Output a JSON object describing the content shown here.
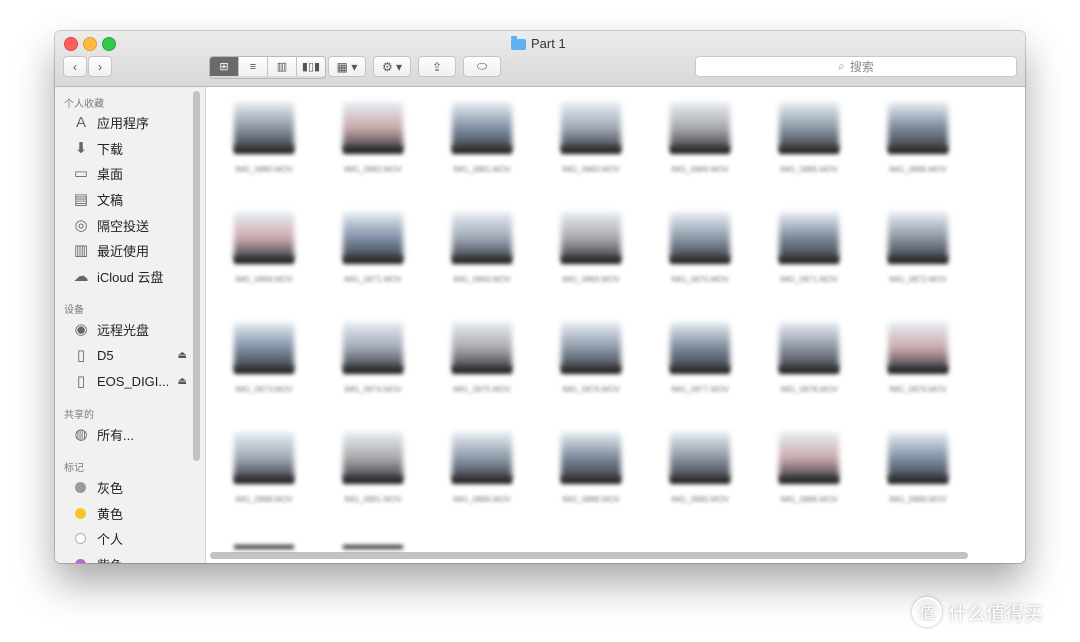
{
  "window": {
    "title": "Part 1"
  },
  "toolbar": {
    "back_icon": "chevron-left",
    "forward_icon": "chevron-right",
    "view_modes": [
      "icon-view",
      "list-view",
      "column-view",
      "cover-flow-view"
    ],
    "view_glyphs": [
      "⊞",
      "≡",
      "▥",
      "▮▯▮"
    ],
    "arrange_glyph": "▦ ▾",
    "action_glyph": "⚙ ▾",
    "share_glyph": "⇪",
    "tag_glyph": "⬭",
    "back_glyph": "‹",
    "forward_glyph": "›"
  },
  "search": {
    "placeholder": "搜索",
    "icon_glyph": "⌕"
  },
  "sidebar": {
    "favorites_header": "个人收藏",
    "favorites": [
      {
        "label": "应用程序",
        "icon": "applications-icon",
        "glyph": "A"
      },
      {
        "label": "下载",
        "icon": "download-icon",
        "glyph": "⬇"
      },
      {
        "label": "桌面",
        "icon": "desktop-icon",
        "glyph": "▭"
      },
      {
        "label": "文稿",
        "icon": "documents-icon",
        "glyph": "▤"
      },
      {
        "label": "隔空投送",
        "icon": "airdrop-icon",
        "glyph": "◎"
      },
      {
        "label": "最近使用",
        "icon": "recents-icon",
        "glyph": "▥"
      },
      {
        "label": "iCloud 云盘",
        "icon": "cloud-icon",
        "glyph": "☁"
      }
    ],
    "devices_header": "设备",
    "devices": [
      {
        "label": "远程光盘",
        "icon": "optical-disc-icon",
        "glyph": "◉"
      },
      {
        "label": "D5",
        "icon": "drive-icon",
        "glyph": "▯",
        "eject": "⏏"
      },
      {
        "label": "EOS_DIGI...",
        "icon": "drive-icon",
        "glyph": "▯",
        "eject": "⏏"
      }
    ],
    "shared_header": "共享的",
    "shared": [
      {
        "label": "所有...",
        "icon": "network-icon",
        "glyph": "◍"
      }
    ],
    "tags_header": "标记",
    "tags": [
      {
        "label": "灰色",
        "color": "#9b9b9b"
      },
      {
        "label": "黄色",
        "color": "#f6c624"
      },
      {
        "label": "个人",
        "color": "#ffffff"
      },
      {
        "label": "紫色",
        "color": "#b566d6"
      }
    ]
  },
  "files": {
    "row1": [
      "IMG_0880.MOV",
      "IMG_0882.MOV",
      "IMG_0881.MOV",
      "IMG_0883.MOV",
      "IMG_0884.MOV",
      "IMG_0885.MOV",
      "IMG_0886.MOV"
    ],
    "row2": [
      "IMG_0868.MOV",
      "IMG_0871.MOV",
      "IMG_0869.MOV",
      "IMG_0869.MOV",
      "IMG_0870.MOV",
      "IMG_0871.MOV",
      "IMG_0872.MOV"
    ],
    "row3": [
      "IMG_0873.MOV",
      "IMG_0874.MOV",
      "IMG_0875.MOV",
      "IMG_0876.MOV",
      "IMG_0877.MOV",
      "IMG_0878.MOV",
      "IMG_0879.MOV"
    ],
    "row4": [
      "IMG_0888.MOV",
      "IMG_0891.MOV",
      "IMG_0889.MOV",
      "IMG_0888.MOV",
      "IMG_0890.MOV",
      "IMG_0886.MOV",
      "IMG_0889.MOV"
    ],
    "thumb_colors": [
      "#8a93a0",
      "#c9a8aa",
      "#7f8fa4",
      "#9ea7b6",
      "#a8a8ac",
      "#8c98a8",
      "#7a8798"
    ]
  },
  "watermark": {
    "mark": "值",
    "text": "什么值得买"
  }
}
